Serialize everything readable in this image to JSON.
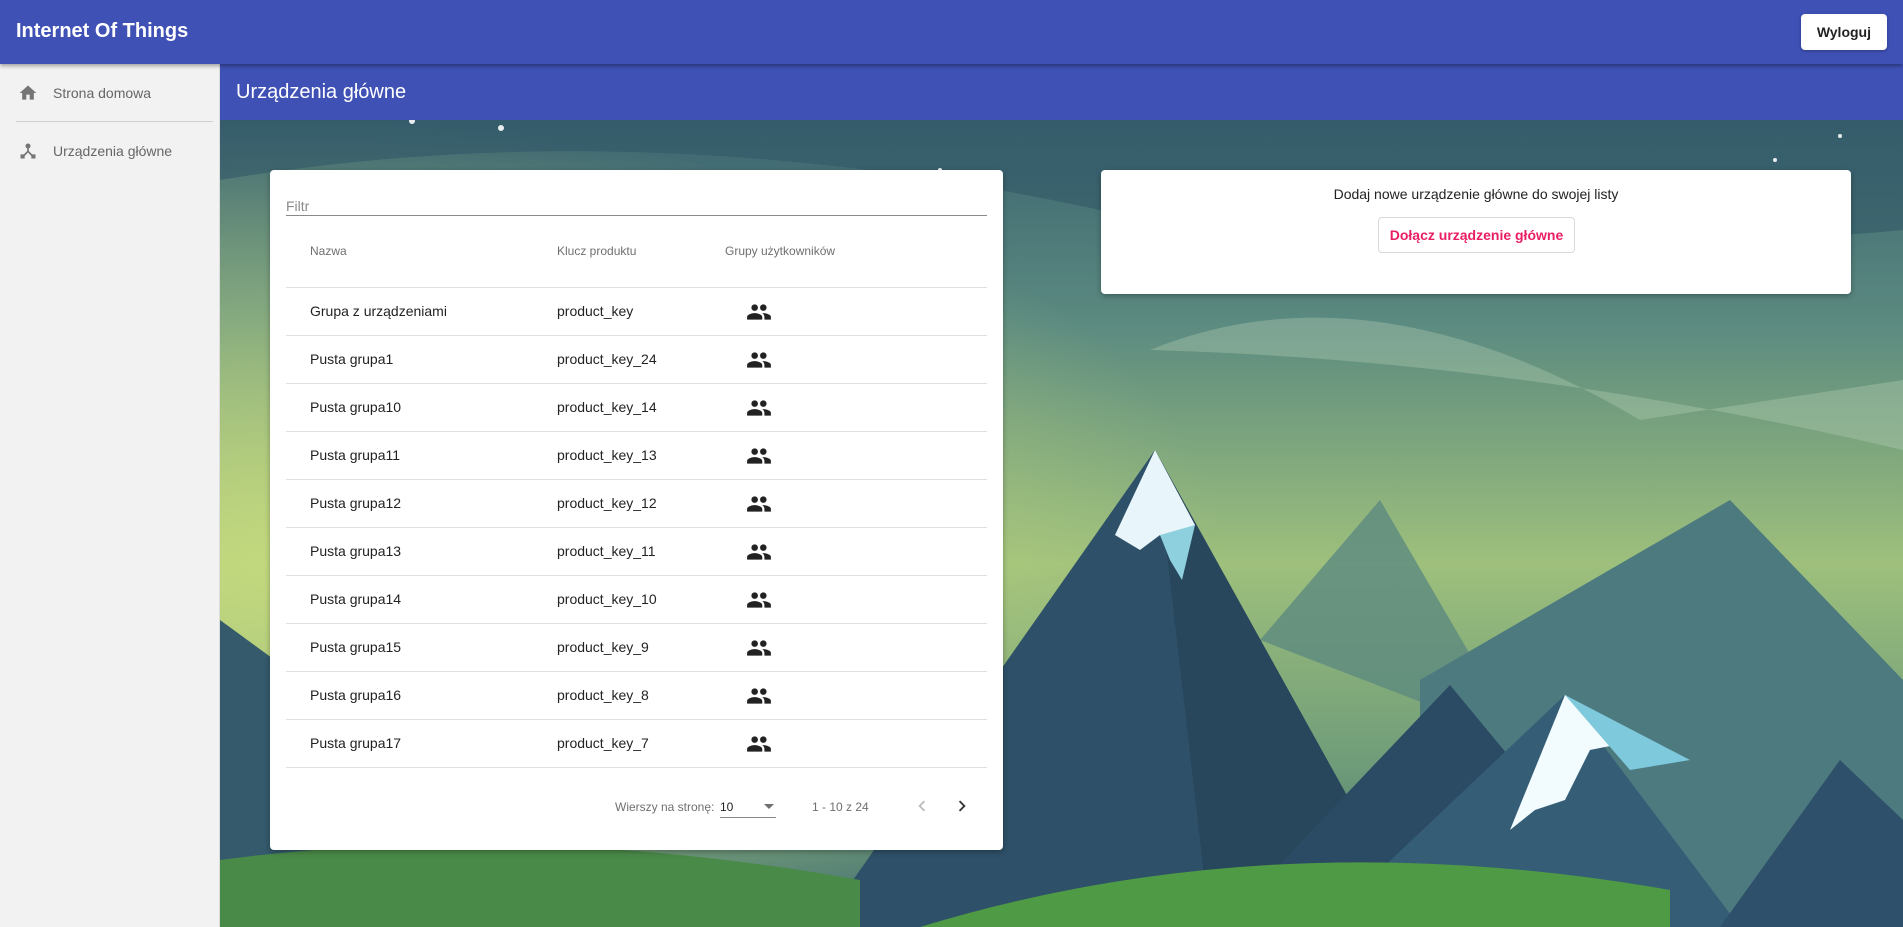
{
  "app": {
    "title": "Internet Of Things",
    "logout_label": "Wyloguj"
  },
  "sidebar": {
    "items": [
      {
        "label": "Strona domowa",
        "icon": "home-icon"
      },
      {
        "label": "Urządzenia główne",
        "icon": "device-hub-icon"
      }
    ]
  },
  "page": {
    "title": "Urządzenia główne"
  },
  "table": {
    "filter_placeholder": "Filtr",
    "columns": {
      "name": "Nazwa",
      "key": "Klucz produktu",
      "groups": "Grupy użytkowników"
    },
    "rows": [
      {
        "name": "Grupa z urządzeniami",
        "key": "product_key",
        "groups_icon": "group-icon"
      },
      {
        "name": "Pusta grupa1",
        "key": "product_key_24",
        "groups_icon": "group-icon"
      },
      {
        "name": "Pusta grupa10",
        "key": "product_key_14",
        "groups_icon": "group-icon"
      },
      {
        "name": "Pusta grupa11",
        "key": "product_key_13",
        "groups_icon": "group-icon"
      },
      {
        "name": "Pusta grupa12",
        "key": "product_key_12",
        "groups_icon": "group-icon"
      },
      {
        "name": "Pusta grupa13",
        "key": "product_key_11",
        "groups_icon": "group-icon"
      },
      {
        "name": "Pusta grupa14",
        "key": "product_key_10",
        "groups_icon": "group-icon"
      },
      {
        "name": "Pusta grupa15",
        "key": "product_key_9",
        "groups_icon": "group-icon"
      },
      {
        "name": "Pusta grupa16",
        "key": "product_key_8",
        "groups_icon": "group-icon"
      },
      {
        "name": "Pusta grupa17",
        "key": "product_key_7",
        "groups_icon": "group-icon"
      }
    ],
    "paginator": {
      "rows_label": "Wierszy na stronę:",
      "page_size": "10",
      "range": "1 - 10 z 24"
    }
  },
  "add_panel": {
    "text": "Dodaj nowe urządzenie główne do swojej listy",
    "button_label": "Dołącz urządzenie główne"
  },
  "colors": {
    "primary": "#3f51b5",
    "accent": "#e91e63"
  }
}
